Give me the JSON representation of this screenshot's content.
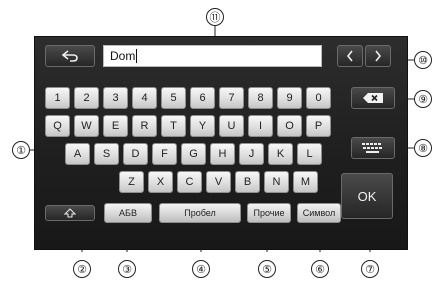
{
  "input": {
    "value": "Dom"
  },
  "keyboard": {
    "row1": [
      "1",
      "2",
      "3",
      "4",
      "5",
      "6",
      "7",
      "8",
      "9",
      "0"
    ],
    "row2": [
      "Q",
      "W",
      "E",
      "R",
      "T",
      "Y",
      "U",
      "I",
      "O",
      "P"
    ],
    "row3": [
      "A",
      "S",
      "D",
      "F",
      "G",
      "H",
      "J",
      "K",
      "L"
    ],
    "row4": [
      "Z",
      "X",
      "C",
      "V",
      "B",
      "N",
      "M"
    ]
  },
  "bottom_bar": {
    "layout_label": "АБВ",
    "space_label": "Пробел",
    "other_label": "Прочие",
    "symbol_label": "Символ"
  },
  "ok_label": "OK",
  "callouts": [
    "1",
    "2",
    "3",
    "4",
    "5",
    "6",
    "7",
    "8",
    "9",
    "10",
    "11"
  ],
  "callout_glyphs": [
    "①",
    "②",
    "③",
    "④",
    "⑤",
    "⑥",
    "⑦",
    "⑧",
    "⑨",
    "⑩",
    "⑪"
  ]
}
